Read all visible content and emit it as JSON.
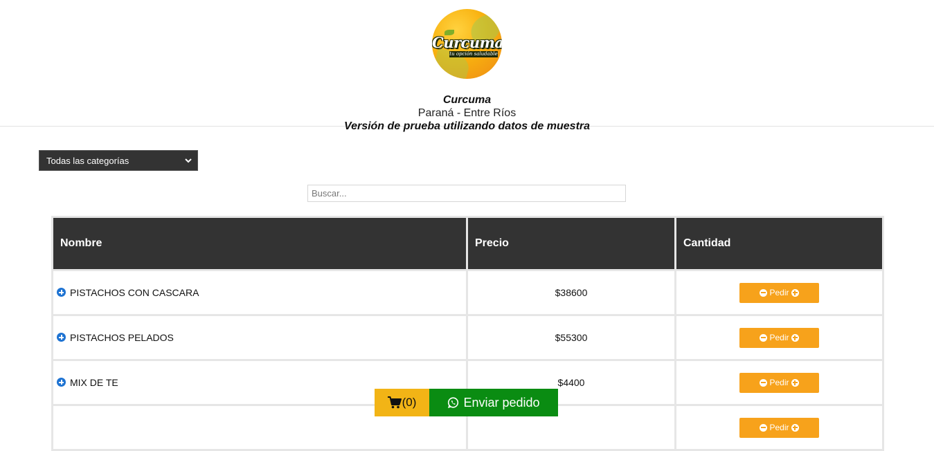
{
  "header": {
    "logo_text": "Curcuma",
    "logo_tagline": "tu opción saludable",
    "store_name": "Curcuma",
    "location": "Paraná - Entre Ríos",
    "note": "Versión de prueba utilizando datos de muestra"
  },
  "filters": {
    "category_selected": "Todas las categorías",
    "search_placeholder": "Buscar..."
  },
  "table": {
    "columns": [
      "Nombre",
      "Precio",
      "Cantidad"
    ],
    "rows": [
      {
        "name": "PISTACHOS CON CASCARA",
        "price": "$38600",
        "action": "Pedir"
      },
      {
        "name": "PISTACHOS PELADOS",
        "price": "$55300",
        "action": "Pedir"
      },
      {
        "name": "MIX DE TE",
        "price": "$4400",
        "action": "Pedir"
      },
      {
        "name": "",
        "price": "",
        "action": "Pedir"
      }
    ]
  },
  "footer": {
    "cart_count": "(0)",
    "send_label": "Enviar pedido"
  },
  "colors": {
    "header_bg": "#333333",
    "order_button": "#f7a21b",
    "cart_button": "#f2b416",
    "send_button": "#0a8c12",
    "plus_icon": "#1e73d2"
  }
}
